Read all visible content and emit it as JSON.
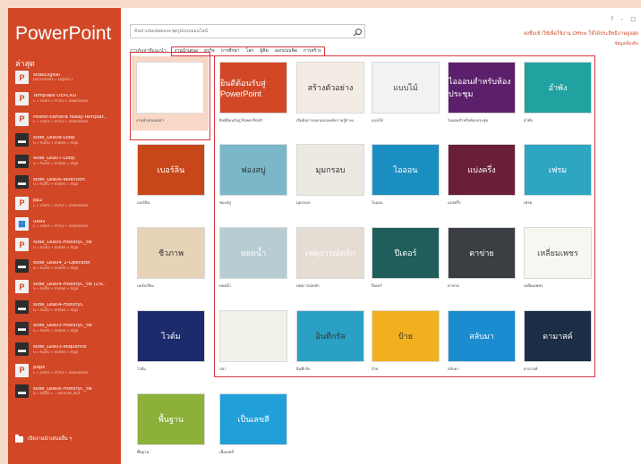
{
  "app": {
    "title": "PowerPoint"
  },
  "window_controls": [
    "?",
    "–",
    "□"
  ],
  "sidebar": {
    "recent_heading": "ล่าสุด",
    "open_other_label": "เปิดงานนำเสนออื่น ๆ",
    "items": [
      {
        "name": "slideDigital",
        "path": "Documents » Digital 1",
        "icon": "powerpoint-file-icon"
      },
      {
        "name": "Template OEPCKU",
        "path": "C » Users » PCKU » Downloads",
        "icon": "powerpoint-file-icon"
      },
      {
        "name": "Poster-camera ready-templat..",
        "path": "C » Users » PCKU » Downloads",
        "icon": "powerpoint-file-icon"
      },
      {
        "name": "slide_Lea08-Loop",
        "path": "G » KuXO » mateo » Algo",
        "icon": "presentation-thumbnail-icon"
      },
      {
        "name": "slide_Lea07-Loop",
        "path": "G » KuXO » mateo » Algo",
        "icon": "presentation-thumbnail-icon"
      },
      {
        "name": "slide_Lea06-selection",
        "path": "G » KuXO » mateo » Algo",
        "icon": "presentation-thumbnail-icon"
      },
      {
        "name": "pp2",
        "path": "C » Users » PCKU » Downloads",
        "icon": "powerpoint-file-icon"
      },
      {
        "name": "แหล่ง",
        "path": "C » Users » PCKU » Downloads",
        "icon": "image-file-icon"
      },
      {
        "name": "slide_Lea05-HistoryC_tw",
        "path": "G » KuXO » mateo » Algo",
        "icon": "powerpoint-file-icon"
      },
      {
        "name": "slide_Lea04_2-Operator",
        "path": "G » KuXO » mateo » Algo",
        "icon": "presentation-thumbnail-icon"
      },
      {
        "name": "slide_Lea04-HistoryC_tw (2)s..",
        "path": "G » KuXO » mateo » Algo",
        "icon": "powerpoint-file-icon"
      },
      {
        "name": "slide_Lea04-HistoryC",
        "path": "G » KuXO » mateo » Algo",
        "icon": "presentation-thumbnail-icon"
      },
      {
        "name": "slide_Lea03-HistoryC_tw",
        "path": "G » KuXO » mateo » Algo",
        "icon": "presentation-thumbnail-icon"
      },
      {
        "name": "slide_Lea03-sequence",
        "path": "G » KuXO » mateo » Algo",
        "icon": "presentation-thumbnail-icon"
      },
      {
        "name": "pdps",
        "path": "C » Users » PCKU » Downloads",
        "icon": "powerpoint-file-icon"
      },
      {
        "name": "slide_Lea06-HistoryC_tw",
        "path": "G » KuXO » ...sornsak_wut..",
        "icon": "presentation-thumbnail-icon"
      }
    ]
  },
  "search": {
    "placeholder": "ค้นหาเทมเพลตและชุดรูปแบบออนไลน์",
    "suggested_label": "การค้นหาที่แนะนำ:",
    "suggested": [
      "งานนำเสนอ",
      "ธุรกิจ",
      "การศึกษา",
      "โลก",
      "ผู้คิด",
      "ออกแบบคิด",
      "การสร้าง"
    ]
  },
  "signin": {
    "text": "ลงชื่อเข้าใช้เพื่อใช้งาน Office ให้ได้ประสิทธิภาพสูงสุด",
    "more": "ข้อมูลเพิ่มเติม"
  },
  "templates": [
    {
      "label": "งานนำเสนอเปล่า",
      "thumb_text": "",
      "bg": "#ffffff",
      "fg": "#333333",
      "selected": true
    },
    {
      "label": "ยินดีต้อนรับสู่ PowerPoint",
      "thumb_text": "ยินดีต้อนรับสู่ PowerPoint",
      "bg": "#d24726",
      "fg": "#ffffff",
      "selected": false
    },
    {
      "label": "เริ่มต้นการออกแบบองค์ความรู้ต่างๆ",
      "thumb_text": "สร้างตัวอย่าง",
      "bg": "#f3ece4",
      "fg": "#333333",
      "selected": false
    },
    {
      "label": "แบบไม้",
      "thumb_text": "แบบไม้",
      "bg": "#f2f2f2",
      "fg": "#444444",
      "selected": false
    },
    {
      "label": "ไอออนสำหรับห้องประชุม",
      "thumb_text": "ไอออนสำหรับห้องประชุม",
      "bg": "#5c1f6b",
      "fg": "#ffffff",
      "selected": false
    },
    {
      "label": "อำพัง",
      "thumb_text": "อำพัง",
      "bg": "#1fa2a0",
      "fg": "#ffffff",
      "selected": false
    },
    {
      "label": "เบอร์ลิน",
      "thumb_text": "เบอร์ลิน",
      "bg": "#c8471a",
      "fg": "#ffffff",
      "selected": false
    },
    {
      "label": "ฟองสบู่",
      "thumb_text": "ฟองสบู่",
      "bg": "#79b7c9",
      "fg": "#333333",
      "selected": false
    },
    {
      "label": "มุมกรอบ",
      "thumb_text": "มุมกรอบ",
      "bg": "#ece9e2",
      "fg": "#333333",
      "selected": false
    },
    {
      "label": "ไอออน",
      "thumb_text": "ไอออน",
      "bg": "#1c8fc2",
      "fg": "#ffffff",
      "selected": false
    },
    {
      "label": "แบ่งครึ่ง",
      "thumb_text": "แบ่งครึ่ง",
      "bg": "#6a1e3a",
      "fg": "#ffffff",
      "selected": false
    },
    {
      "label": "เฟรม",
      "thumb_text": "เฟรม",
      "bg": "#2ea6c2",
      "fg": "#ffffff",
      "selected": false
    },
    {
      "label": "บอร์ดเรียบ",
      "thumb_text": "ชีวภาพ",
      "bg": "#e6d3b8",
      "fg": "#333333",
      "selected": false
    },
    {
      "label": "หยดน้ำ",
      "thumb_text": "หยดน้ำ",
      "bg": "#b7cdd3",
      "fg": "#ffffff",
      "selected": false
    },
    {
      "label": "เหตุการณ์หลัก",
      "thumb_text": "เหตุการณ์หลัก",
      "bg": "#e5dcd3",
      "fg": "#ffffff",
      "selected": false
    },
    {
      "label": "ปีเตอร์",
      "thumb_text": "ปีเตอร์",
      "bg": "#1f5e5b",
      "fg": "#ffffff",
      "selected": false
    },
    {
      "label": "ตาข่าย",
      "thumb_text": "ตาข่าย",
      "bg": "#3b3f44",
      "fg": "#ffffff",
      "selected": false
    },
    {
      "label": "เหลี่ยมเพชร",
      "thumb_text": "เหลี่ยมเพชร",
      "bg": "#f5f8f0",
      "fg": "#444444",
      "selected": false
    },
    {
      "label": "ไวต์ม",
      "thumb_text": "ไวต์ม",
      "bg": "#1b2b6b",
      "fg": "#ffffff",
      "selected": false
    },
    {
      "label": "ปลา",
      "thumb_text": "",
      "bg": "#f2f2ea",
      "fg": "#333333",
      "selected": false
    },
    {
      "label": "อินทีกรัล",
      "thumb_text": "อินทีกรัล",
      "bg": "#2aa0c4",
      "fg": "#333333",
      "selected": false
    },
    {
      "label": "ป้าย",
      "thumb_text": "ป้าย",
      "bg": "#f2b01e",
      "fg": "#333333",
      "selected": false
    },
    {
      "label": "สลับมา",
      "thumb_text": "สลับมา",
      "bg": "#1a8ccf",
      "fg": "#ffffff",
      "selected": false
    },
    {
      "label": "ดามาสค์",
      "thumb_text": "ดามาสค์",
      "bg": "#1b2e45",
      "fg": "#ffffff",
      "selected": false
    },
    {
      "label": "พื้นฐาน",
      "thumb_text": "พื้นฐาน",
      "bg": "#8cb03a",
      "fg": "#ffffff",
      "selected": false
    },
    {
      "label": "เนื้อเยลลี่",
      "thumb_text": "เป็นเลขสี",
      "bg": "#219fd8",
      "fg": "#ffffff",
      "selected": false
    }
  ]
}
